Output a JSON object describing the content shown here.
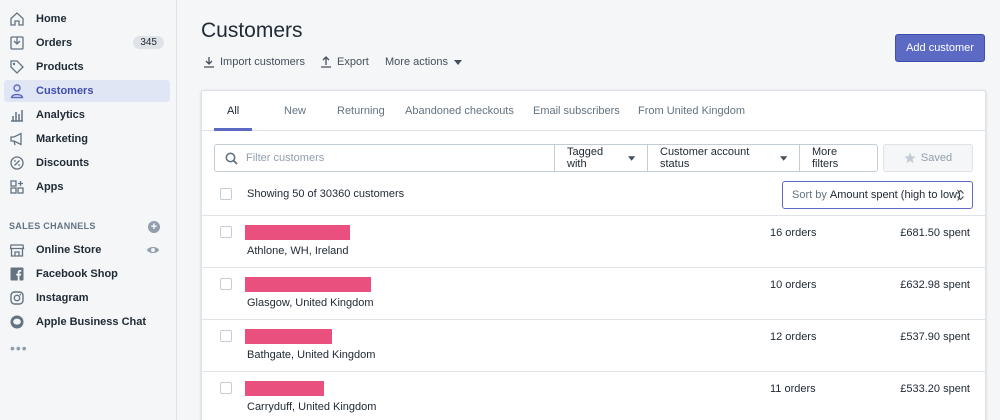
{
  "sidebar": {
    "items": [
      {
        "label": "Home",
        "icon": "home-icon"
      },
      {
        "label": "Orders",
        "icon": "orders-icon",
        "badge": "345"
      },
      {
        "label": "Products",
        "icon": "tag-icon"
      },
      {
        "label": "Customers",
        "icon": "person-icon",
        "active": true
      },
      {
        "label": "Analytics",
        "icon": "bar-chart-icon"
      },
      {
        "label": "Marketing",
        "icon": "megaphone-icon"
      },
      {
        "label": "Discounts",
        "icon": "discount-icon"
      },
      {
        "label": "Apps",
        "icon": "apps-icon"
      }
    ],
    "sales_channels_heading": "SALES CHANNELS",
    "channels": [
      {
        "label": "Online Store",
        "icon": "store-icon"
      },
      {
        "label": "Facebook Shop",
        "icon": "facebook-icon"
      },
      {
        "label": "Instagram",
        "icon": "instagram-icon"
      },
      {
        "label": "Apple Business Chat",
        "icon": "chat-icon"
      }
    ]
  },
  "header": {
    "title": "Customers",
    "import_label": "Import customers",
    "export_label": "Export",
    "more_actions_label": "More actions",
    "add_button_label": "Add customer"
  },
  "tabs": [
    "All",
    "New",
    "Returning",
    "Abandoned checkouts",
    "Email subscribers",
    "From United Kingdom"
  ],
  "filters": {
    "search_placeholder": "Filter customers",
    "tagged_with": "Tagged with",
    "account_status": "Customer account status",
    "more_filters": "More filters",
    "saved": "Saved"
  },
  "list": {
    "showing": "Showing 50 of 30360 customers",
    "sort_key": "Sort by",
    "sort_value": "Amount spent (high to low)"
  },
  "customers": [
    {
      "location": "Athlone, WH, Ireland",
      "orders": "16 orders",
      "spent": "£681.50 spent",
      "name_redacted": true
    },
    {
      "location": "Glasgow, United Kingdom",
      "orders": "10 orders",
      "spent": "£632.98 spent",
      "name_redacted": true
    },
    {
      "location": "Bathgate, United Kingdom",
      "orders": "12 orders",
      "spent": "£537.90 spent",
      "name_redacted": true
    },
    {
      "location": "Carryduff, United Kingdom",
      "orders": "11 orders",
      "spent": "£533.20 spent",
      "name_redacted": true
    }
  ],
  "colors": {
    "accent": "#5c6ac4",
    "redaction": "#e9507e",
    "sidebar_active_bg": "#e1e6f4"
  }
}
